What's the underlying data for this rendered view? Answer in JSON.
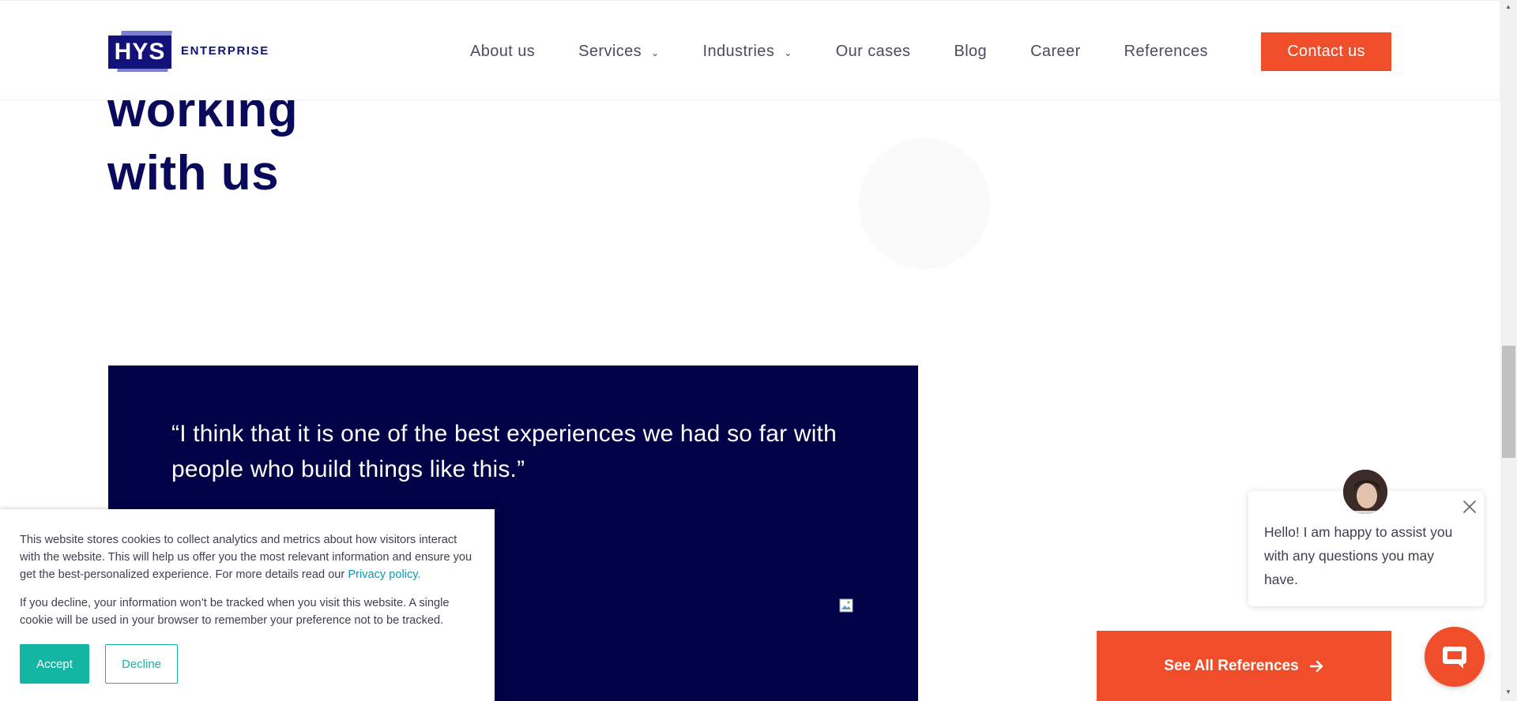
{
  "header": {
    "logo_mark": "HYS",
    "logo_text": "ENTERPRISE",
    "nav": [
      {
        "label": "About us"
      },
      {
        "label": "Services"
      },
      {
        "label": "Industries"
      },
      {
        "label": "Our cases"
      },
      {
        "label": "Blog"
      },
      {
        "label": "Career"
      },
      {
        "label": "References"
      }
    ],
    "contact_label": "Contact us"
  },
  "hero": {
    "line1": "working",
    "line2": "with us"
  },
  "quote": {
    "text": "“I think that it is one of the best experiences we had so far with people who build things like this.”"
  },
  "see_all": {
    "label": "See All References",
    "icon": "arrow-right-icon"
  },
  "cookie": {
    "paragraph1": "This website stores cookies to collect analytics and metrics about how visitors interact with the website. This will help us offer you the most relevant information and ensure you get the best-personalized experience. For more details read our ",
    "privacy_link": "Privacy policy.",
    "paragraph2": "If you decline, your information won’t be tracked when you visit this website. A single cookie will be used in your browser to remember your preference not to be tracked.",
    "accept_label": "Accept",
    "decline_label": "Decline"
  },
  "chat": {
    "message": "Hello! I am happy to assist you with any questions you may have."
  },
  "colors": {
    "brand_navy": "#0a0a5c",
    "accent_orange": "#f04e2b",
    "cookie_teal": "#13b5a3",
    "quote_bg": "#010147"
  }
}
